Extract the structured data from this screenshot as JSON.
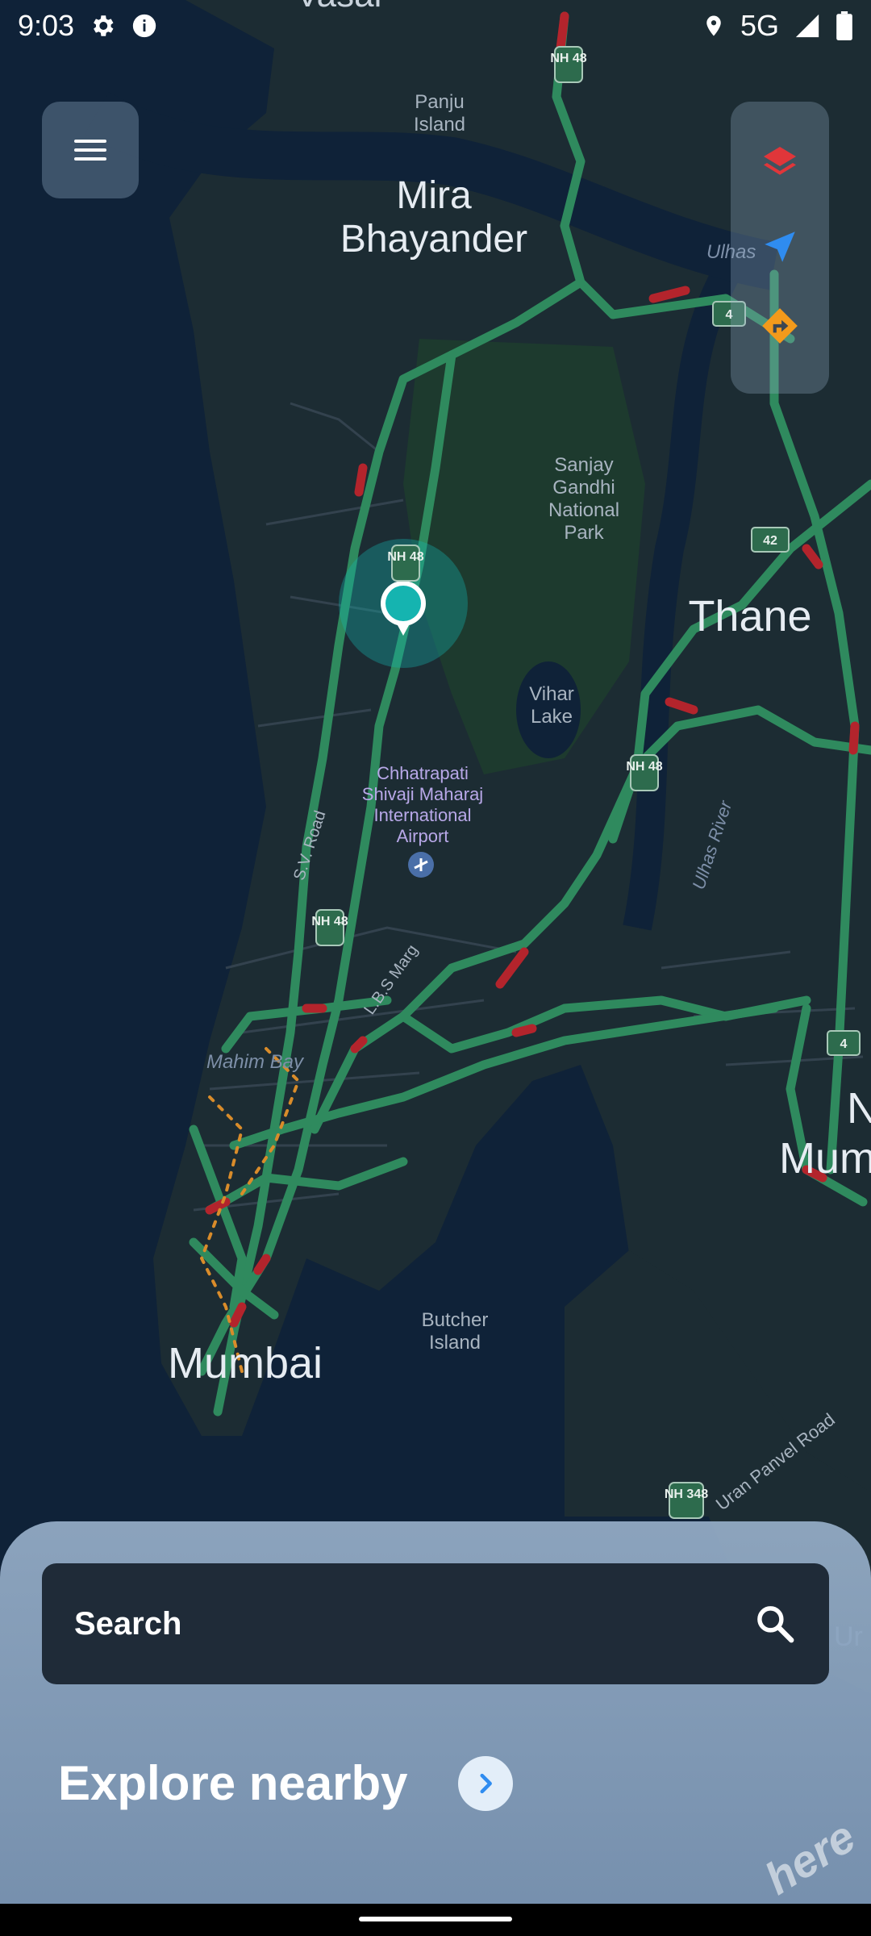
{
  "status_bar": {
    "time": "9:03",
    "network": "5G",
    "icons": [
      "gear-icon",
      "info-icon",
      "location-icon",
      "signal-icon",
      "battery-icon"
    ]
  },
  "map": {
    "city_labels": [
      "Mira",
      "Bhayander",
      "Thane",
      "Mumbai",
      "Na",
      "Mum"
    ],
    "place_labels": [
      "Vasai",
      "Panju",
      "Island",
      "Sanjay",
      "Gandhi",
      "National",
      "Park",
      "Vihar",
      "Lake",
      "Chhatrapati",
      "Shivaji Maharaj",
      "International",
      "Airport",
      "Mahim Bay",
      "Butcher",
      "Island",
      "Ulhas",
      "Ur"
    ],
    "road_labels": [
      "S.V. Road",
      "L.B.S Marg",
      "Ulhas River",
      "Uran Panvel Road"
    ],
    "shields": [
      "NH 48",
      "NH 48",
      "NH 48",
      "NH 48",
      "4",
      "42",
      "4",
      "NH 348"
    ],
    "location_marker": "current-location"
  },
  "controls": {
    "menu_icon": "hamburger-menu-icon",
    "layers_icon": "layers-icon",
    "navigate_icon": "navigation-arrow-icon",
    "route_icon": "route-directions-icon"
  },
  "sheet": {
    "search_label": "Search",
    "search_icon": "search-icon",
    "explore_label": "Explore nearby",
    "explore_icon": "chevron-right-icon"
  },
  "brand": {
    "logo_text": "here"
  },
  "colors": {
    "map_water": "#0f2238",
    "map_land": "#1d2d33",
    "traffic_green": "#2f8a5e",
    "traffic_red": "#b3242c",
    "marker_teal": "#15b4b0",
    "layers_red": "#e0363a",
    "nav_blue": "#2f8cf0",
    "route_orange": "#f39a1b"
  }
}
